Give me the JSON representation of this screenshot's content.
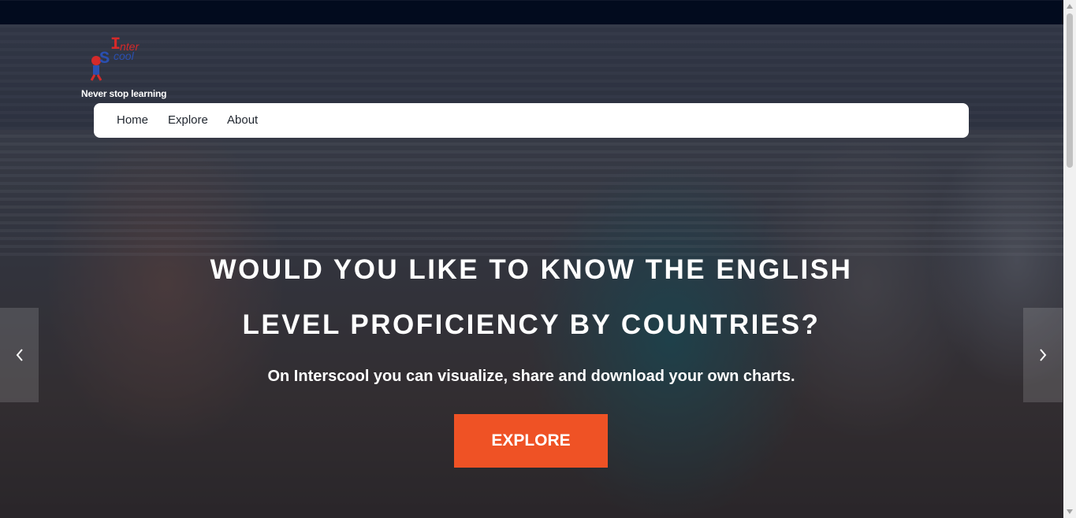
{
  "brand": {
    "logo_text_top": "Inter",
    "logo_text_bottom": "Scool",
    "tagline": "Never stop learning"
  },
  "nav": {
    "items": [
      {
        "label": "Home"
      },
      {
        "label": "Explore"
      },
      {
        "label": "About"
      }
    ]
  },
  "hero": {
    "headline_line1": "WOULD YOU LIKE TO KNOW THE ENGLISH",
    "headline_line2": "LEVEL PROFICIENCY BY COUNTRIES?",
    "subheadline": "On Interscool you can visualize, share and download your own charts.",
    "cta_label": "EXPLORE"
  },
  "carousel": {
    "prev_icon": "chevron-left-icon",
    "next_icon": "chevron-right-icon"
  },
  "colors": {
    "accent": "#ef5225",
    "topbar": "#020b1e",
    "nav_background": "#ffffff",
    "logo_red": "#d42a2a",
    "logo_blue": "#2a4fb0"
  }
}
